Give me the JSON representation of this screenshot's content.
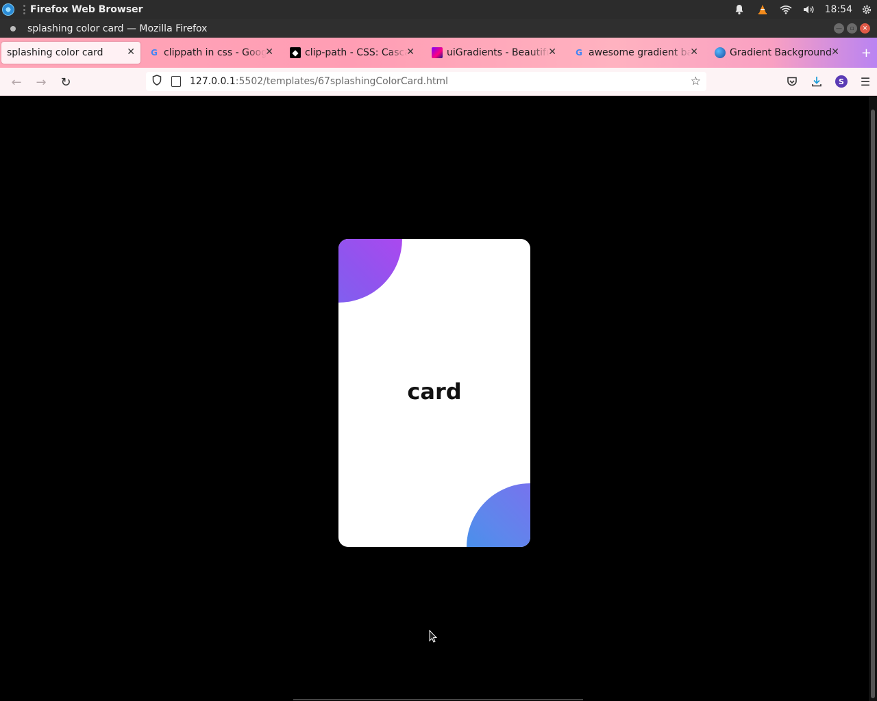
{
  "system_bar": {
    "app_name": "Firefox Web Browser",
    "clock": "18:54"
  },
  "window": {
    "title": "splashing color card — Mozilla Firefox"
  },
  "tabs": [
    {
      "label": "splashing color card",
      "favicon": "none",
      "active": true
    },
    {
      "label": "clippath in css - Google",
      "favicon": "google-icon"
    },
    {
      "label": "clip-path - CSS: Cascadi",
      "favicon": "mdn-icon"
    },
    {
      "label": "uiGradients - Beautiful",
      "favicon": "uigradients-icon"
    },
    {
      "label": "awesome gradient bac",
      "favicon": "google-icon"
    },
    {
      "label": "Gradient Backgrounds",
      "favicon": "gradient-backgrounds-icon"
    }
  ],
  "navbar": {
    "url_host": "127.0.0.1",
    "url_path": ":5502/templates/67splashingColorCard.html",
    "account_initial": "S"
  },
  "card": {
    "title": "card",
    "gradient_top_left": [
      "#6f6cf0",
      "#8f55ee",
      "#c13ef0"
    ],
    "gradient_bottom_right": [
      "#2f9be9",
      "#5f86ec",
      "#8a63ef"
    ]
  },
  "colors": {
    "page_background": "#000000",
    "card_background": "#ffffff",
    "tabstrip_start": "#ffa6b8",
    "tabstrip_end": "#b983f2"
  }
}
